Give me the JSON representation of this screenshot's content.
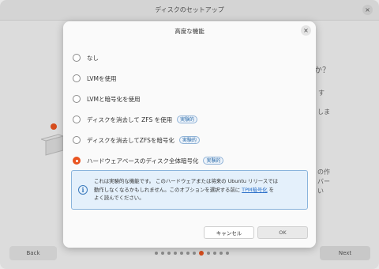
{
  "background": {
    "title": "ディスクのセットアップ",
    "close_icon": "×",
    "fragments": [
      "か？",
      "す",
      "しま",
      "の作",
      "バー",
      "い"
    ],
    "back_label": "Back",
    "next_label": "Next",
    "step_count": 13,
    "active_step": 8
  },
  "dialog": {
    "title": "高度な機能",
    "close_icon": "×",
    "options": [
      {
        "label": "なし",
        "checked": false,
        "badge": ""
      },
      {
        "label": "LVMを使用",
        "checked": false,
        "badge": ""
      },
      {
        "label": "LVMと暗号化を使用",
        "checked": false,
        "badge": ""
      },
      {
        "label": "ディスクを消去して ZFS を使用",
        "checked": false,
        "badge": "実験的"
      },
      {
        "label": "ディスクを消去してZFSを暗号化",
        "checked": false,
        "badge": "実験的"
      },
      {
        "label": "ハードウェアベースのディスク全体暗号化",
        "checked": true,
        "badge": "実験的"
      }
    ],
    "info": {
      "icon": "i",
      "line1": "これは実験的な機能です。 このハードウェアまたは将来の Ubuntu リリースでは",
      "line2_pre": "動作しなくなるかもしれません。このオプションを選択する前に ",
      "link": "TPM暗号化",
      "line2_post": " を",
      "line3": "よく読んでください。"
    },
    "cancel_label": "キャンセル",
    "ok_label": "OK"
  },
  "colors": {
    "accent": "#e95420",
    "info_bg": "#e4f0fb",
    "info_border": "#8ab4dc",
    "link": "#2a6fc9"
  }
}
